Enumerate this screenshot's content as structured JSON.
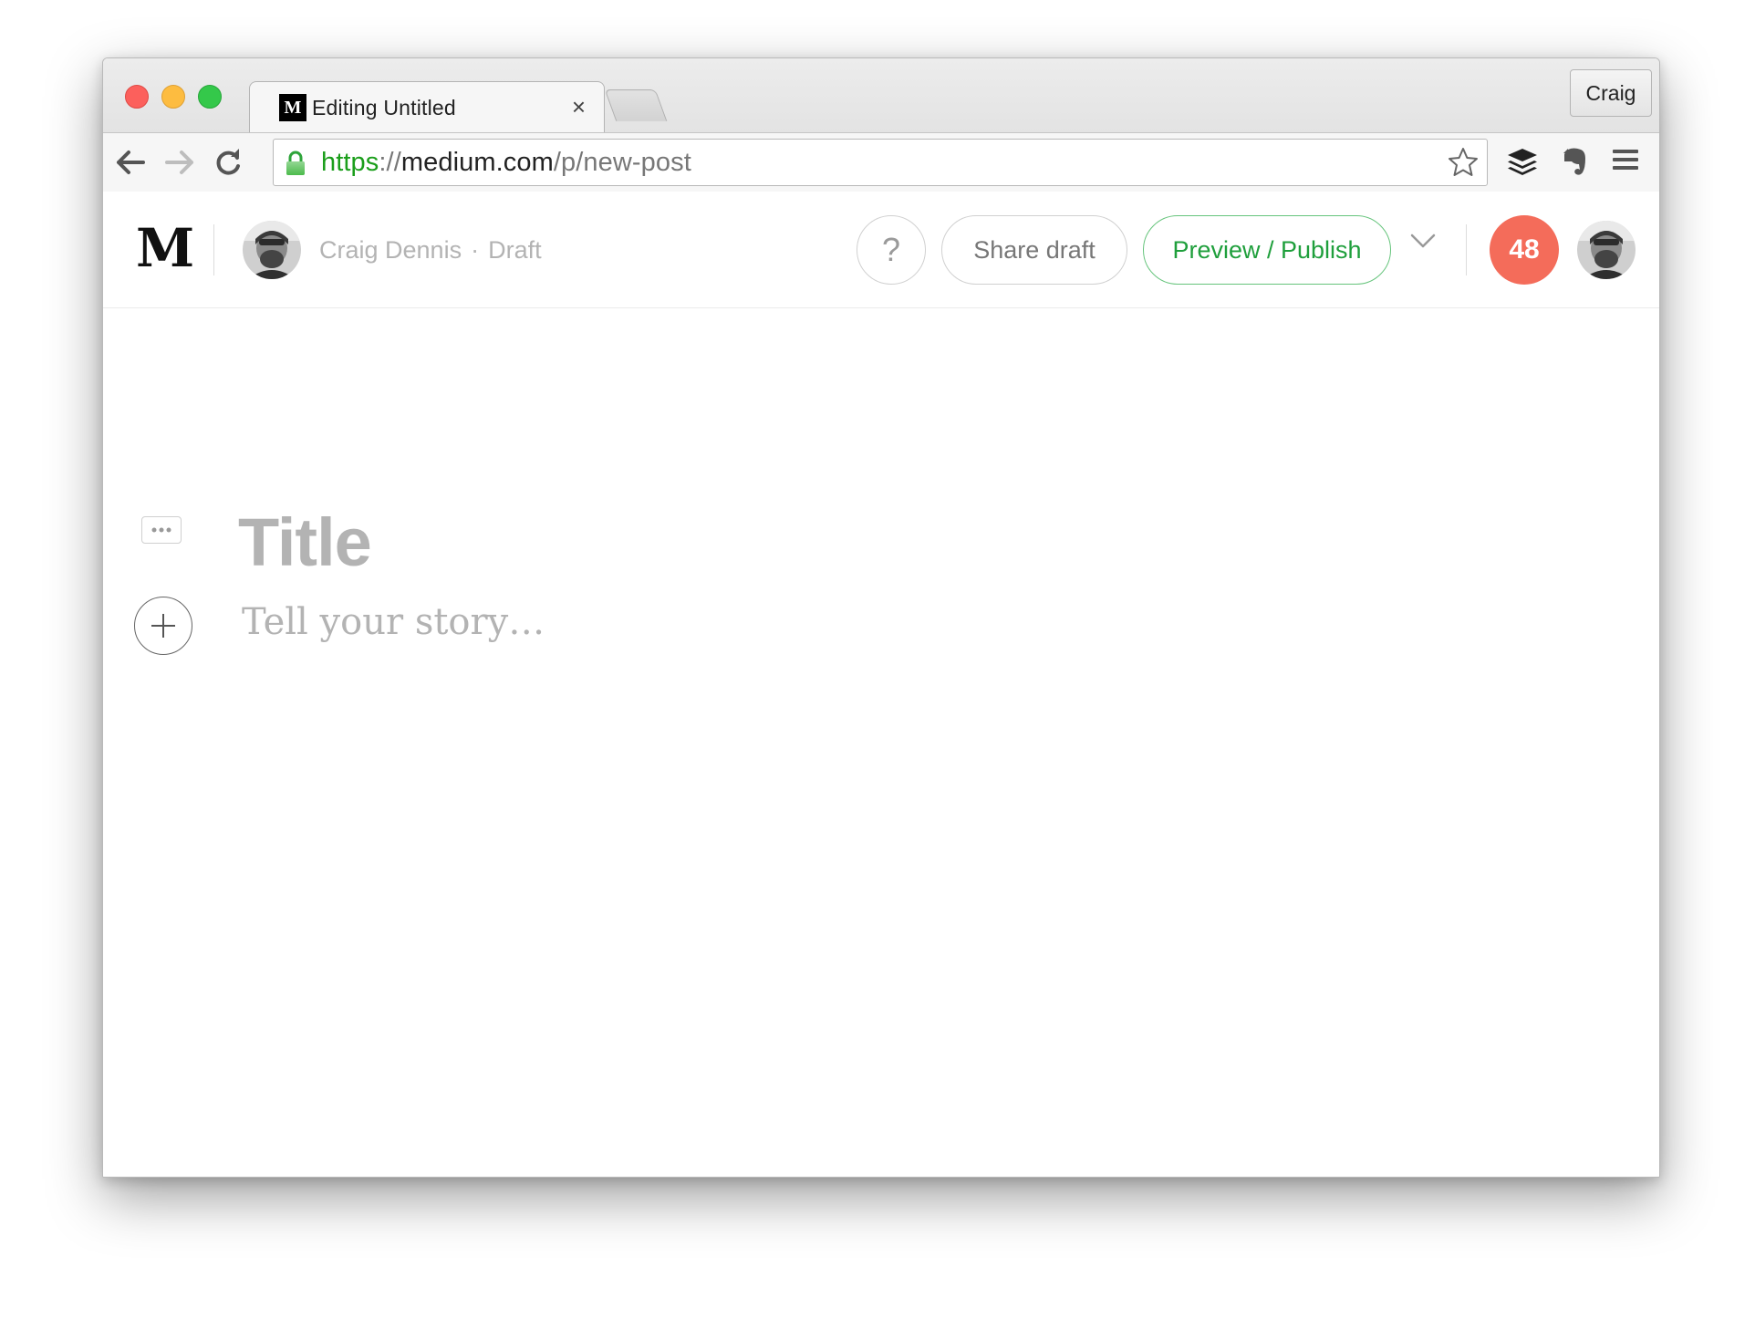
{
  "browser": {
    "tab": {
      "favicon_letter": "M",
      "title": "Editing Untitled",
      "close_glyph": "×"
    },
    "profile_name": "Craig",
    "url": {
      "scheme": "https",
      "separator": "://",
      "host": "medium.com",
      "path": "/p/new-post"
    },
    "toolbar_icons": [
      "back-arrow-icon",
      "forward-arrow-icon",
      "reload-icon",
      "lock-icon",
      "bookmark-star-icon",
      "buffer-extension-icon",
      "evernote-extension-icon",
      "menu-icon"
    ]
  },
  "medium": {
    "logo": "M",
    "author_name": "Craig Dennis",
    "separator": "·",
    "status": "Draft",
    "help_label": "?",
    "share_label": "Share draft",
    "publish_label": "Preview / Publish",
    "notification_count": "48"
  },
  "editor": {
    "title_placeholder": "Title",
    "body_placeholder": "Tell your story…"
  },
  "colors": {
    "accent_green": "#1f9f3c",
    "notification_red": "#f46c5a",
    "url_scheme_green": "#1b9e1b",
    "placeholder_gray": "#b3b3b3"
  }
}
